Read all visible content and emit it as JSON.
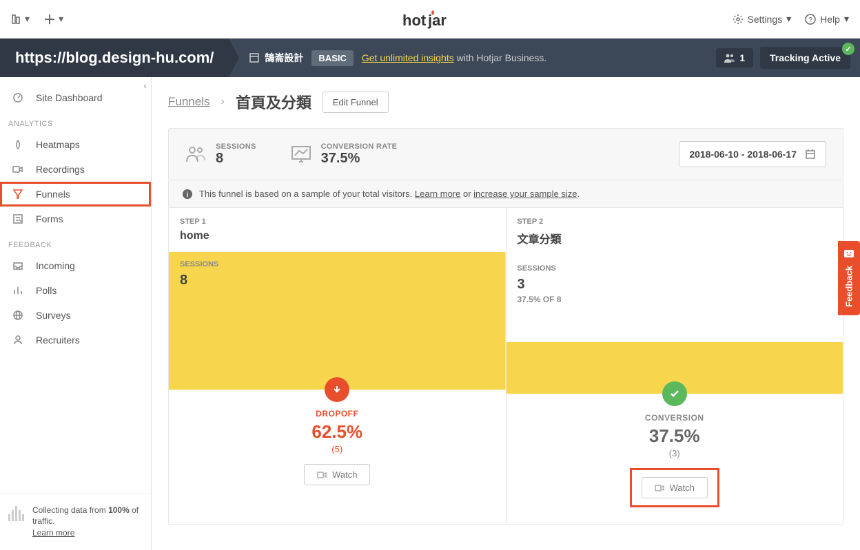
{
  "topbar": {
    "settings": "Settings",
    "help": "Help"
  },
  "logo": {
    "text": "hotjar"
  },
  "header": {
    "url": "https://blog.design-hu.com/",
    "site_name": "鵠崙設計",
    "plan_badge": "BASIC",
    "upgrade_link": "Get unlimited insights",
    "upgrade_suffix": " with Hotjar Business.",
    "user_count": "1",
    "tracking_status": "Tracking Active"
  },
  "sidebar": {
    "dashboard": "Site Dashboard",
    "analytics_label": "ANALYTICS",
    "analytics": [
      {
        "id": "heatmaps",
        "label": "Heatmaps"
      },
      {
        "id": "recordings",
        "label": "Recordings"
      },
      {
        "id": "funnels",
        "label": "Funnels"
      },
      {
        "id": "forms",
        "label": "Forms"
      }
    ],
    "feedback_label": "FEEDBACK",
    "feedback": [
      {
        "id": "incoming",
        "label": "Incoming"
      },
      {
        "id": "polls",
        "label": "Polls"
      },
      {
        "id": "surveys",
        "label": "Surveys"
      },
      {
        "id": "recruiters",
        "label": "Recruiters"
      }
    ],
    "footer": {
      "line1": "Collecting data from ",
      "bold": "100%",
      "line1_suffix": " of traffic.",
      "learn_more": "Learn more"
    }
  },
  "breadcrumb": {
    "parent": "Funnels",
    "title": "首頁及分類",
    "edit_btn": "Edit Funnel"
  },
  "metrics": {
    "sessions_label": "SESSIONS",
    "sessions_value": "8",
    "conversion_label": "CONVERSION RATE",
    "conversion_value": "37.5%",
    "date_range": "2018-06-10 - 2018-06-17"
  },
  "info": {
    "text": "This funnel is based on a sample of your total visitors. ",
    "learn_more": "Learn more",
    "or": " or ",
    "increase": "increase your sample size",
    "period": "."
  },
  "funnel": {
    "steps": [
      {
        "step_label": "STEP 1",
        "name": "home",
        "sessions_label": "SESSIONS",
        "sessions_value": "8",
        "sessions_sub": "",
        "result_type": "dropoff",
        "result_label": "DROPOFF",
        "result_value": "62.5%",
        "result_count": "(5)",
        "watch": "Watch"
      },
      {
        "step_label": "STEP 2",
        "name": "文章分類",
        "sessions_label": "SESSIONS",
        "sessions_value": "3",
        "sessions_sub": "37.5% OF 8",
        "result_type": "conversion",
        "result_label": "CONVERSION",
        "result_value": "37.5%",
        "result_count": "(3)",
        "watch": "Watch"
      }
    ]
  },
  "feedback_tab": "Feedback"
}
